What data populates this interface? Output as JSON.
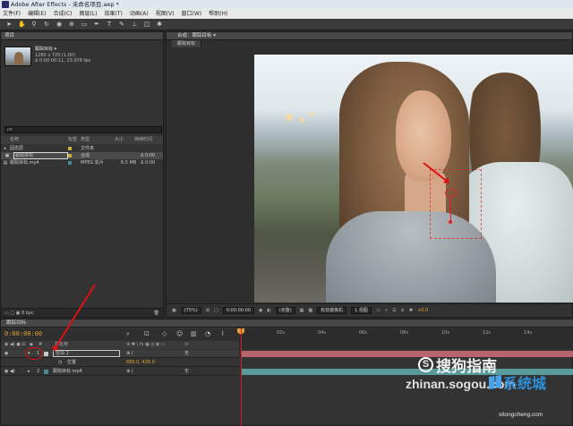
{
  "window": {
    "title": "Adobe After Effects - 未命名项目.aep *"
  },
  "menu": [
    "文件(F)",
    "编辑(E)",
    "合成(C)",
    "图层(L)",
    "效果(T)",
    "动画(A)",
    "视图(V)",
    "窗口(W)",
    "帮助(H)"
  ],
  "project_panel": {
    "tab": "项目",
    "comp_name": "跟踪目标 ▾",
    "info_lines": [
      "1280 x 720 (1.00)",
      "Δ 0:00:00:11, 23.976 fps"
    ],
    "search_placeholder": "ρ▾",
    "columns": [
      "名称",
      "标签",
      "类型",
      "大小",
      "持续时间"
    ],
    "rows": [
      {
        "name": "固态层",
        "type": "文件夹",
        "size": "",
        "dur": "",
        "color": "#c8b040"
      },
      {
        "name": "跟踪目标",
        "type": "合成",
        "size": "",
        "dur": "Δ 0:00",
        "color": "#c8b040"
      },
      {
        "name": "跟踪目标.mp4",
        "type": "MPEG 影片",
        "size": "6.5 MB",
        "dur": "Δ 0:00",
        "color": "#4a8a9a"
      }
    ],
    "bpc": "8 bpc"
  },
  "viewer": {
    "tab": "合成：跟踪目标 ▾",
    "subtab": "跟踪目标",
    "zoom": "(75%)",
    "timecode": "0:00:00:00",
    "resolution": "(完整)",
    "camera": "有效摄像机",
    "views": "1 视图",
    "exposure": "+0.0"
  },
  "timeline": {
    "tab": "跟踪目标",
    "timecode": "0:00:00:00",
    "header_label": "源名称",
    "layers": [
      {
        "num": "1",
        "name": "空白 1",
        "mode": "无",
        "color": "#c8c8c8"
      },
      {
        "num": "",
        "name": "位置",
        "value": "686.0, 426.0",
        "color": ""
      },
      {
        "num": "2",
        "name": "跟踪目标.mp4",
        "mode": "无",
        "color": "#4a8a9a"
      }
    ],
    "ticks": [
      "02s",
      "04s",
      "06s",
      "08s",
      "10s",
      "12s",
      "14s"
    ]
  },
  "watermark": {
    "brand_cn": "搜狗指南",
    "url1": "zhinan.sogou.com",
    "brand2": "系统城",
    "url2": "xitongcheng.com"
  },
  "colors": {
    "annotation": "#e01010",
    "timecode": "#e0a030",
    "playhead": "#d02020"
  }
}
